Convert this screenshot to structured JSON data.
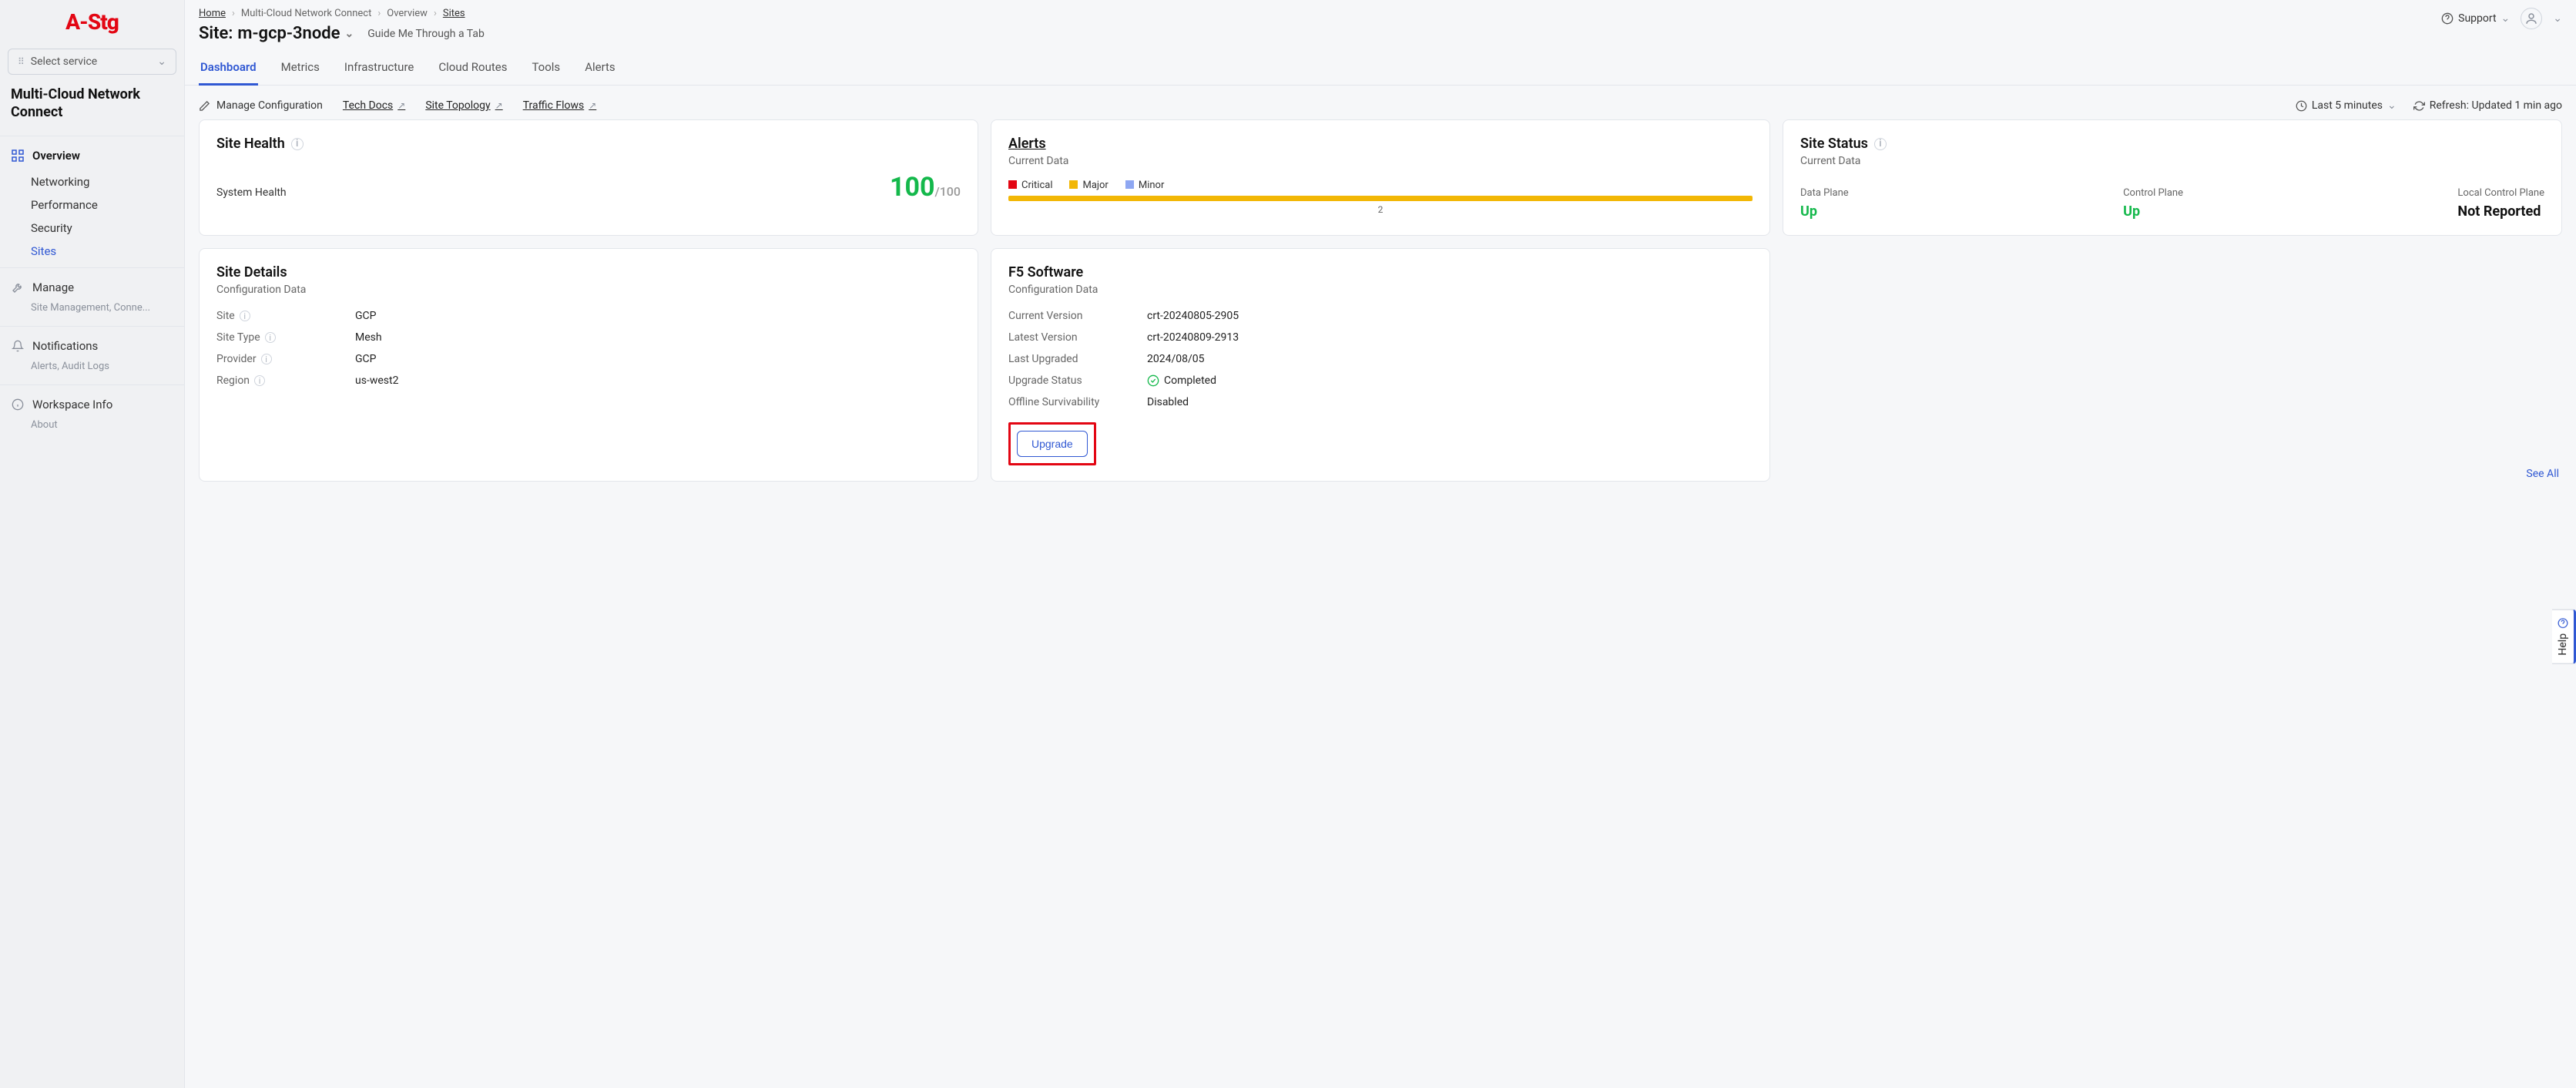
{
  "brand": "A-Stg",
  "service_select_label": "Select service",
  "sidebar_title": "Multi-Cloud Network Connect",
  "sidebar": {
    "overview": "Overview",
    "networking": "Networking",
    "performance": "Performance",
    "security": "Security",
    "sites": "Sites",
    "manage": "Manage",
    "manage_desc": "Site Management, Conne...",
    "notifications": "Notifications",
    "notifications_desc": "Alerts, Audit Logs",
    "workspace": "Workspace Info",
    "workspace_desc": "About"
  },
  "breadcrumbs": {
    "home": "Home",
    "a": "Multi-Cloud Network Connect",
    "b": "Overview",
    "c": "Sites"
  },
  "page_title_prefix": "Site:",
  "page_title_site": "m-gcp-3node",
  "guide_label": "Guide Me Through a Tab",
  "support_label": "Support",
  "tabs": {
    "dashboard": "Dashboard",
    "metrics": "Metrics",
    "infrastructure": "Infrastructure",
    "cloud_routes": "Cloud Routes",
    "tools": "Tools",
    "alerts": "Alerts"
  },
  "toolbar": {
    "manage_config": "Manage Configuration",
    "tech_docs": "Tech Docs",
    "site_topology": "Site Topology",
    "traffic_flows": "Traffic Flows",
    "time_range": "Last 5 minutes",
    "refresh": "Refresh: Updated 1 min ago"
  },
  "site_health": {
    "title": "Site Health",
    "system_health_label": "System Health",
    "score": "100",
    "max": "/100"
  },
  "alerts_card": {
    "title": "Alerts",
    "subtitle": "Current Data",
    "legend_crit": "Critical",
    "legend_major": "Major",
    "legend_minor": "Minor",
    "count": "2"
  },
  "site_status": {
    "title": "Site Status",
    "subtitle": "Current Data",
    "data_plane_label": "Data Plane",
    "data_plane_val": "Up",
    "control_plane_label": "Control Plane",
    "control_plane_val": "Up",
    "local_cp_label": "Local Control Plane",
    "local_cp_val": "Not Reported"
  },
  "site_details": {
    "title": "Site Details",
    "subtitle": "Configuration Data",
    "site_label": "Site",
    "site_val": "GCP",
    "site_type_label": "Site Type",
    "site_type_val": "Mesh",
    "provider_label": "Provider",
    "provider_val": "GCP",
    "region_label": "Region",
    "region_val": "us-west2"
  },
  "f5_software": {
    "title": "F5 Software",
    "subtitle": "Configuration Data",
    "current_ver_label": "Current Version",
    "current_ver_val": "crt-20240805-2905",
    "latest_ver_label": "Latest Version",
    "latest_ver_val": "crt-20240809-2913",
    "last_upgraded_label": "Last Upgraded",
    "last_upgraded_val": "2024/08/05",
    "upgrade_status_label": "Upgrade Status",
    "upgrade_status_val": "Completed",
    "offline_surv_label": "Offline Survivability",
    "offline_surv_val": "Disabled",
    "upgrade_btn": "Upgrade"
  },
  "see_all": "See All",
  "help_label": "Help"
}
